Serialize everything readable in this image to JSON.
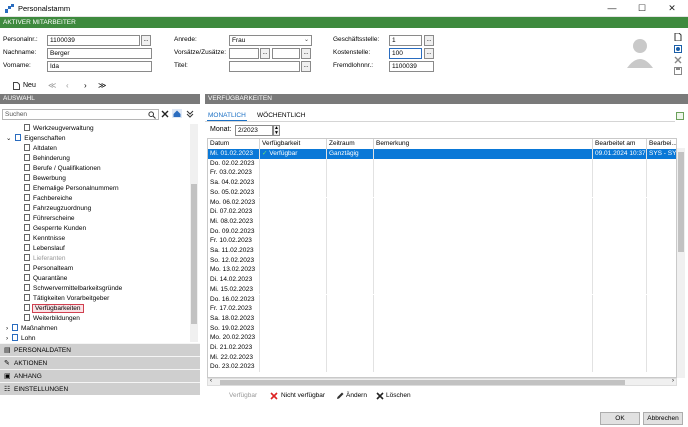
{
  "window": {
    "title": "Personalstamm",
    "minimize": "—",
    "maximize": "☐",
    "close": "✕"
  },
  "banner": "AKTIVER MITARBEITER",
  "form": {
    "personalnr_label": "Personalnr.:",
    "personalnr": "1100039",
    "nachname_label": "Nachname:",
    "nachname": "Berger",
    "vorname_label": "Vorname:",
    "vorname": "Ida",
    "anrede_label": "Anrede:",
    "anrede": "Frau",
    "vorsaetze_label": "Vorsätze/Zusätze:",
    "vorsaetze": "",
    "titel_label": "Titel:",
    "titel": "",
    "geschaeftsstelle_label": "Geschäftsstelle:",
    "geschaeftsstelle": "1",
    "kostenstelle_label": "Kostenstelle:",
    "kostenstelle": "100",
    "fremdlohn_label": "Fremdlohnnr.:",
    "fremdlohn": "1100039",
    "dots": "..."
  },
  "toolbar": {
    "new_label": "Neu",
    "first": "≪",
    "prev": "‹",
    "next": "›",
    "last": "≫"
  },
  "left": {
    "header": "AUSWAHL",
    "search_placeholder": "Suchen",
    "tree": [
      {
        "label": "Werkzeugverwaltung",
        "indent": 2
      },
      {
        "label": "Eigenschaften",
        "indent": 1,
        "expanded": true
      },
      {
        "label": "Altdaten",
        "indent": 2
      },
      {
        "label": "Behinderung",
        "indent": 2
      },
      {
        "label": "Berufe / Qualifikationen",
        "indent": 2
      },
      {
        "label": "Bewerbung",
        "indent": 2
      },
      {
        "label": "Ehemalige Personalnummern",
        "indent": 2
      },
      {
        "label": "Fachbereiche",
        "indent": 2
      },
      {
        "label": "Fahrzeugzuordnung",
        "indent": 2
      },
      {
        "label": "Führerscheine",
        "indent": 2
      },
      {
        "label": "Gesperrte Kunden",
        "indent": 2
      },
      {
        "label": "Kenntnisse",
        "indent": 2
      },
      {
        "label": "Lebenslauf",
        "indent": 2
      },
      {
        "label": "Lieferanten",
        "indent": 2,
        "dim": true
      },
      {
        "label": "Personalteam",
        "indent": 2
      },
      {
        "label": "Quarantäne",
        "indent": 2
      },
      {
        "label": "Schwervermittelbarkeitsgründe",
        "indent": 2
      },
      {
        "label": "Tätigkeiten Vorarbeitgeber",
        "indent": 2
      },
      {
        "label": "Verfügbarkeiten",
        "indent": 2,
        "selected": true
      },
      {
        "label": "Weiterbildungen",
        "indent": 2
      },
      {
        "label": "Maßnahmen",
        "indent": 1,
        "collapsed": true
      },
      {
        "label": "Lohn",
        "indent": 1,
        "collapsed": true
      }
    ],
    "accordion": [
      {
        "label": "PERSONALDATEN",
        "icon": "▤"
      },
      {
        "label": "AKTIONEN",
        "icon": "✎"
      },
      {
        "label": "ANHANG",
        "icon": "▣"
      },
      {
        "label": "EINSTELLUNGEN",
        "icon": "☷"
      }
    ]
  },
  "right": {
    "header": "VERFÜGBARKEITEN",
    "tabs": [
      "MONATLICH",
      "WÖCHENTLICH"
    ],
    "month_label": "Monat:",
    "month_value": "2/2023",
    "columns": [
      "Datum",
      "Verfügbarkeit",
      "Zeitraum",
      "Bemerkung",
      "Bearbeitet am",
      "Bearbei..."
    ],
    "rows": [
      {
        "datum": "Mi. 01.02.2023",
        "verf": "Verfügbar",
        "zeit": "Ganztägig",
        "bem": "",
        "am": "09.01.2024 10:37",
        "von": "SYS - SYS"
      },
      {
        "datum": "Do. 02.02.2023"
      },
      {
        "datum": "Fr.   03.02.2023"
      },
      {
        "datum": "Sa.  04.02.2023"
      },
      {
        "datum": "So.  05.02.2023"
      },
      {
        "datum": "Mo. 06.02.2023"
      },
      {
        "datum": "Di.   07.02.2023"
      },
      {
        "datum": "Mi.  08.02.2023"
      },
      {
        "datum": "Do. 09.02.2023"
      },
      {
        "datum": "Fr.   10.02.2023"
      },
      {
        "datum": "Sa.  11.02.2023"
      },
      {
        "datum": "So.  12.02.2023"
      },
      {
        "datum": "Mo. 13.02.2023"
      },
      {
        "datum": "Di.   14.02.2023"
      },
      {
        "datum": "Mi.  15.02.2023"
      },
      {
        "datum": "Do. 16.02.2023"
      },
      {
        "datum": "Fr.   17.02.2023"
      },
      {
        "datum": "Sa.  18.02.2023"
      },
      {
        "datum": "So.  19.02.2023"
      },
      {
        "datum": "Mo. 20.02.2023"
      },
      {
        "datum": "Di.   21.02.2023"
      },
      {
        "datum": "Mi.  22.02.2023"
      },
      {
        "datum": "Do. 23.02.2023"
      }
    ],
    "actions": {
      "verfuegbar": "Verfügbar",
      "nicht": "Nicht verfügbar",
      "aendern": "Ändern",
      "loeschen": "Löschen"
    }
  },
  "footer": {
    "ok": "OK",
    "cancel": "Abbrechen"
  },
  "colors": {
    "accent_green": "#3e8a3e",
    "selection_blue": "#0a78d7",
    "header_gray": "#7a7a7a",
    "tab_blue": "#1a6fc4"
  }
}
